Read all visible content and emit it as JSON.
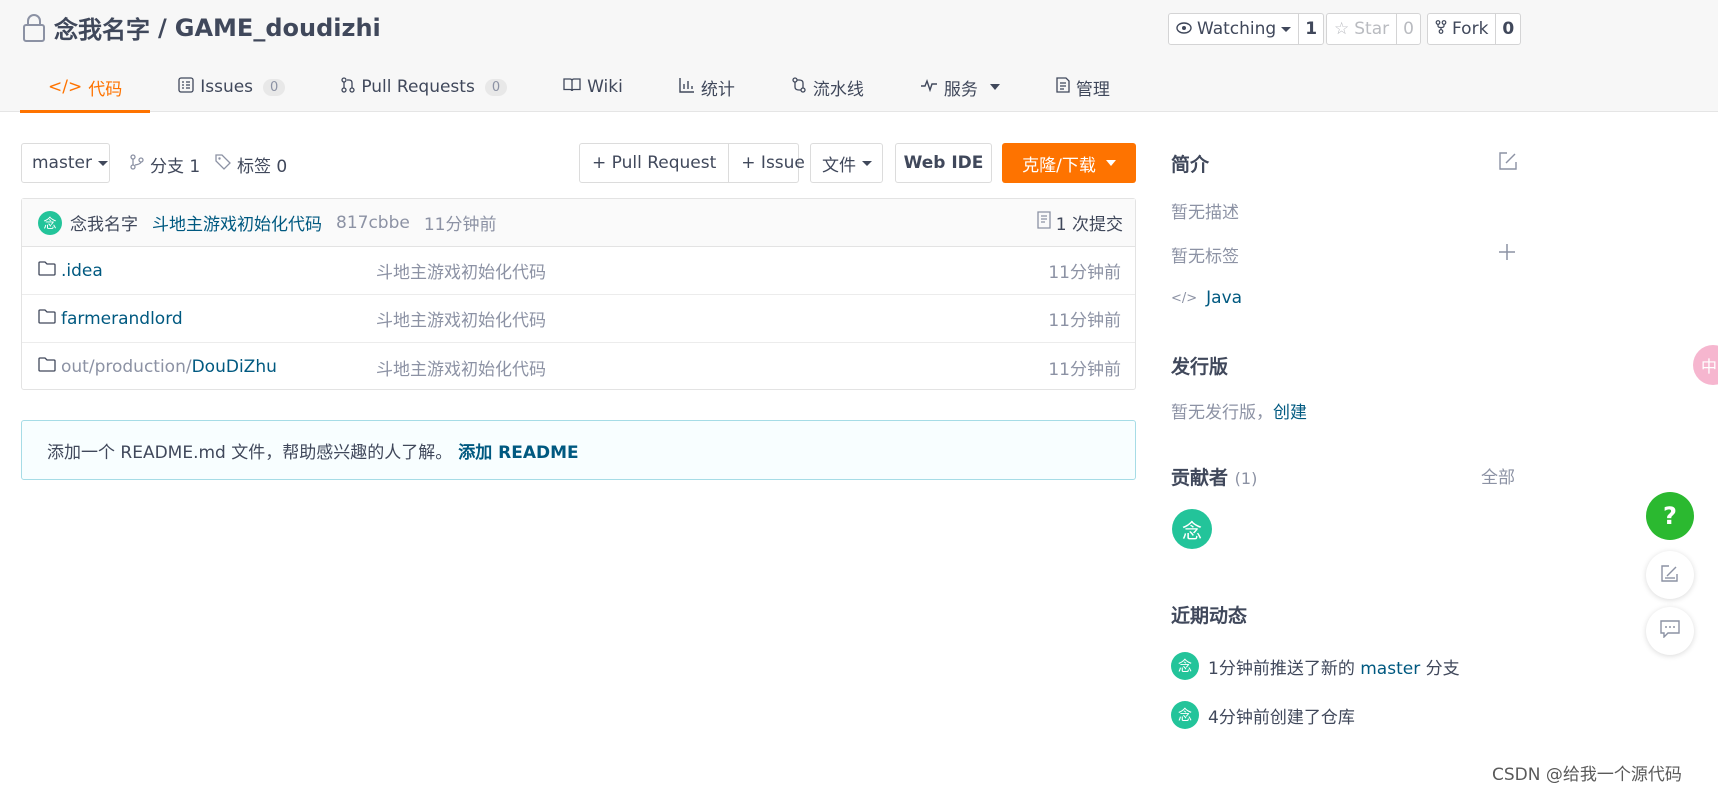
{
  "repo": {
    "owner": "念我名字",
    "separator": "/",
    "name": "GAME_doudizhi"
  },
  "header_buttons": {
    "watch": {
      "label": "Watching",
      "count": "1"
    },
    "star": {
      "label": "Star",
      "count": "0"
    },
    "fork": {
      "label": "Fork",
      "count": "0"
    }
  },
  "tabs": [
    {
      "label": "代码",
      "active": true
    },
    {
      "label": "Issues",
      "count": "0"
    },
    {
      "label": "Pull Requests",
      "count": "0"
    },
    {
      "label": "Wiki"
    },
    {
      "label": "统计"
    },
    {
      "label": "流水线"
    },
    {
      "label": "服务"
    },
    {
      "label": "管理"
    }
  ],
  "toolbar": {
    "branch": "master",
    "branches": "分支 1",
    "tags": "标签 0",
    "pull_request": "+ Pull Request",
    "issue": "+ Issue",
    "file": "文件",
    "web_ide": "Web IDE",
    "clone": "克隆/下载"
  },
  "commit": {
    "avatar": "念",
    "author": "念我名字",
    "message": "斗地主游戏初始化代码",
    "hash": "817cbbe",
    "time": "11分钟前",
    "count_label": "1 次提交"
  },
  "files": [
    {
      "prefix": "",
      "name": ".idea",
      "message": "斗地主游戏初始化代码",
      "time": "11分钟前"
    },
    {
      "prefix": "",
      "name": "farmerandlord",
      "message": "斗地主游戏初始化代码",
      "time": "11分钟前"
    },
    {
      "prefix": "out/production/",
      "name": "DouDiZhu",
      "message": "斗地主游戏初始化代码",
      "time": "11分钟前"
    }
  ],
  "readme": {
    "text": "添加一个 README.md 文件，帮助感兴趣的人了解。",
    "link": "添加 README"
  },
  "sidebar": {
    "intro_title": "简介",
    "no_desc": "暂无描述",
    "no_tags": "暂无标签",
    "language": "Java",
    "release_title": "发行版",
    "no_release": "暂无发行版，",
    "create": "创建",
    "contrib_title": "贡献者",
    "contrib_count": "(1)",
    "all": "全部",
    "contrib_avatar": "念",
    "activity_title": "近期动态",
    "activities": [
      {
        "avatar": "念",
        "pre": "1分钟前推送了新的 ",
        "link": "master",
        "post": " 分支"
      },
      {
        "avatar": "念",
        "pre": "4分钟前创建了仓库",
        "link": "",
        "post": ""
      }
    ]
  },
  "floating": {
    "help": "?",
    "side_tab": "中"
  },
  "watermark": "CSDN @给我一个源代码",
  "colors": {
    "accent": "#fe7300",
    "link": "#005980",
    "avatar": "#23c49a",
    "help": "#2bb930"
  }
}
